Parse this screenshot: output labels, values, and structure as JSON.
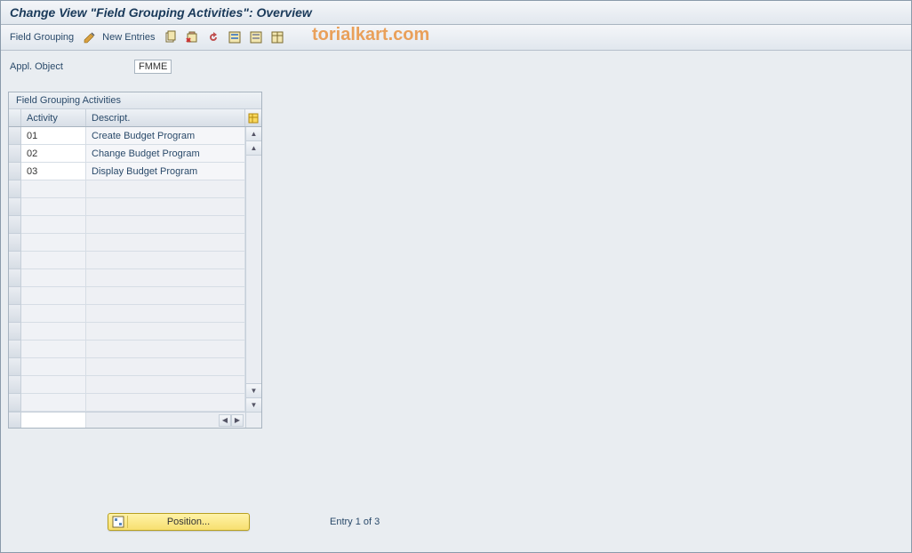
{
  "title": "Change View \"Field Grouping Activities\": Overview",
  "toolbar": {
    "field_grouping_label": "Field Grouping",
    "new_entries_label": "New Entries"
  },
  "watermark": "torialkart.com",
  "appl_object": {
    "label": "Appl. Object",
    "value": "FMME"
  },
  "table": {
    "title": "Field Grouping Activities",
    "columns": {
      "activity": "Activity",
      "description": "Descript."
    },
    "rows": [
      {
        "activity": "01",
        "description": "Create Budget Program"
      },
      {
        "activity": "02",
        "description": "Change Budget Program"
      },
      {
        "activity": "03",
        "description": "Display Budget Program"
      },
      {
        "activity": "",
        "description": ""
      },
      {
        "activity": "",
        "description": ""
      },
      {
        "activity": "",
        "description": ""
      },
      {
        "activity": "",
        "description": ""
      },
      {
        "activity": "",
        "description": ""
      },
      {
        "activity": "",
        "description": ""
      },
      {
        "activity": "",
        "description": ""
      },
      {
        "activity": "",
        "description": ""
      },
      {
        "activity": "",
        "description": ""
      },
      {
        "activity": "",
        "description": ""
      },
      {
        "activity": "",
        "description": ""
      },
      {
        "activity": "",
        "description": ""
      },
      {
        "activity": "",
        "description": ""
      }
    ]
  },
  "footer": {
    "position_label": "Position...",
    "entry_text": "Entry 1 of 3"
  }
}
